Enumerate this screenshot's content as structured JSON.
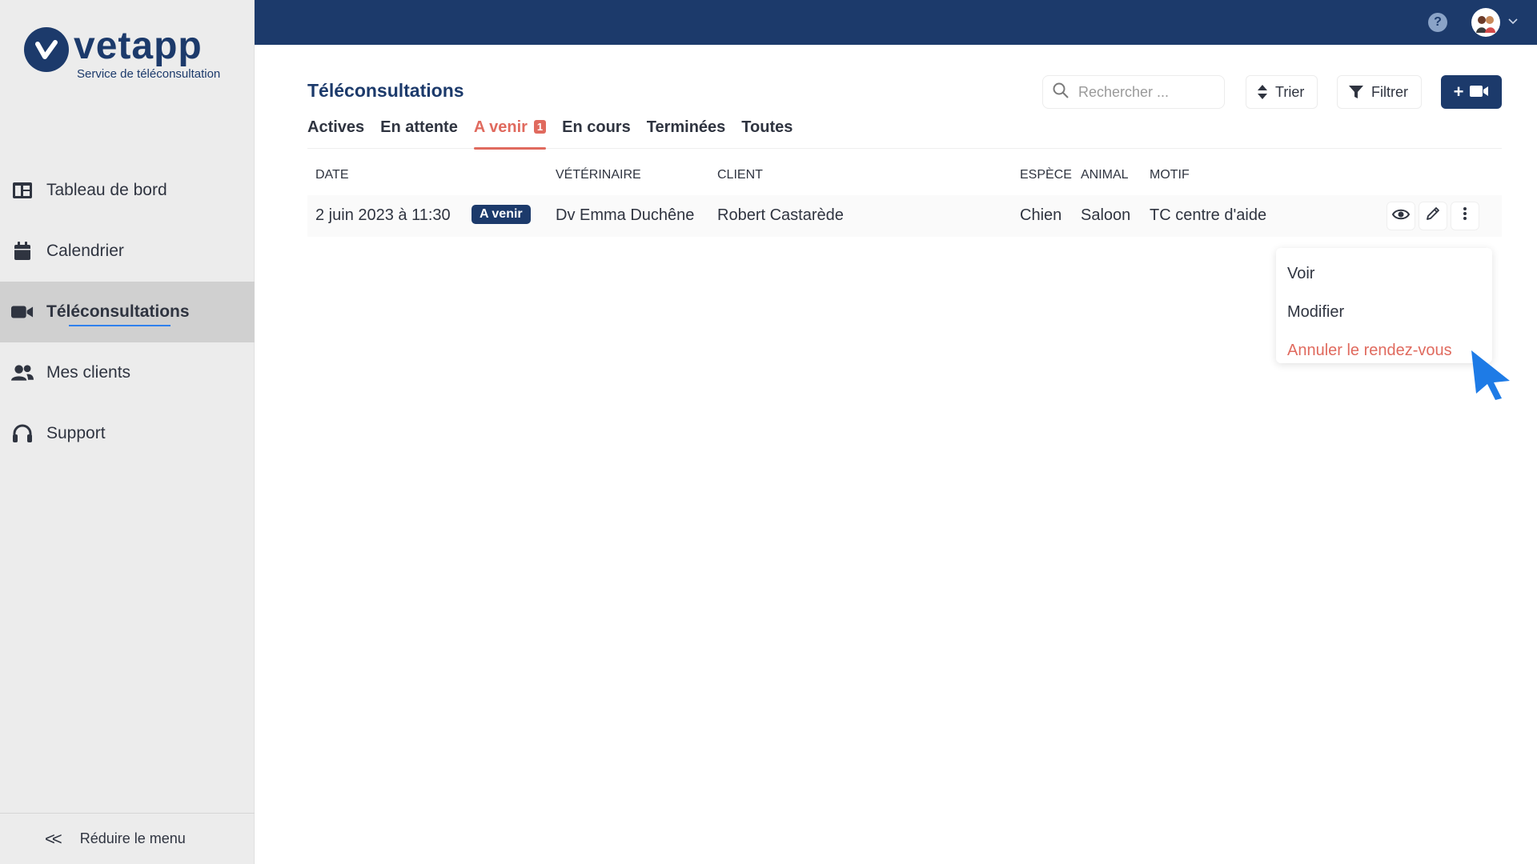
{
  "app": {
    "logo_word": "vetapp",
    "logo_subtitle": "Service de téléconsultation"
  },
  "sidebar": {
    "items": [
      {
        "label": "Tableau de bord",
        "icon": "dashboard-icon"
      },
      {
        "label": "Calendrier",
        "icon": "calendar-icon"
      },
      {
        "label": "Téléconsultations",
        "icon": "video-camera-icon",
        "active": true
      },
      {
        "label": "Mes clients",
        "icon": "users-icon"
      },
      {
        "label": "Support",
        "icon": "headset-icon"
      }
    ],
    "collapse_label": "Réduire le menu"
  },
  "header": {
    "help_icon": "help-icon",
    "help_glyph": "?",
    "avatar_icon": "avatar"
  },
  "main": {
    "title": "Téléconsultations",
    "search_placeholder": "Rechercher ...",
    "sort_label": "Trier",
    "filter_label": "Filtrer",
    "add_label": "+",
    "tabs": [
      {
        "label": "Actives"
      },
      {
        "label": "En attente"
      },
      {
        "label": "A venir",
        "badge": "1",
        "active": true
      },
      {
        "label": "En cours"
      },
      {
        "label": "Terminées"
      },
      {
        "label": "Toutes"
      }
    ],
    "columns": [
      "DATE",
      "VÉTÉRINAIRE",
      "CLIENT",
      "ESPÈCE",
      "ANIMAL",
      "MOTIF"
    ],
    "rows": [
      {
        "date": "2 juin 2023 à 11:30",
        "status": "A venir",
        "veterinaire": "Dv Emma Duchêne",
        "client": "Robert Castarède",
        "espece": "Chien",
        "animal": "Saloon",
        "motif": "TC centre d'aide"
      }
    ],
    "row_menu": [
      "Voir",
      "Modifier",
      "Annuler le rendez-vous"
    ]
  },
  "colors": {
    "primary": "#1c3a6b",
    "accent": "#e06a5e",
    "cursor": "#1e7be6"
  }
}
